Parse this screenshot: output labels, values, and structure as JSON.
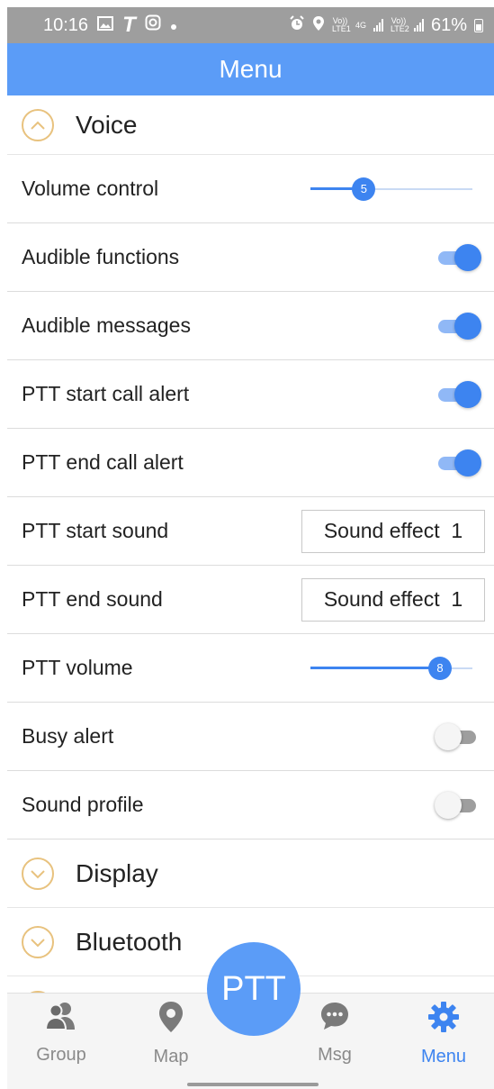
{
  "status_bar": {
    "time": "10:16",
    "left_icons": [
      "gallery-icon",
      "t-icon",
      "instagram-icon",
      "dot-icon"
    ],
    "volte1": "Vo)) LTE1",
    "network": "4G",
    "volte2": "Vo)) LTE2",
    "battery": "61%"
  },
  "app_bar": {
    "title": "Menu"
  },
  "sections": {
    "voice": {
      "title": "Voice"
    },
    "display": {
      "title": "Display"
    },
    "bluetooth": {
      "title": "Bluetooth"
    }
  },
  "settings": {
    "volume_control": {
      "label": "Volume control",
      "value": "5",
      "fraction": 0.33
    },
    "audible_functions": {
      "label": "Audible functions",
      "enabled": true
    },
    "audible_messages": {
      "label": "Audible messages",
      "enabled": true
    },
    "ptt_start_call_alert": {
      "label": "PTT start call alert",
      "enabled": true
    },
    "ptt_end_call_alert": {
      "label": "PTT end call alert",
      "enabled": true
    },
    "ptt_start_sound": {
      "label": "PTT start sound",
      "value": "Sound effect  1"
    },
    "ptt_end_sound": {
      "label": "PTT end sound",
      "value": "Sound effect  1"
    },
    "ptt_volume": {
      "label": "PTT volume",
      "value": "8",
      "fraction": 0.8
    },
    "busy_alert": {
      "label": "Busy alert",
      "enabled": false
    },
    "sound_profile": {
      "label": "Sound profile",
      "enabled": false
    }
  },
  "ptt_button": {
    "label": "PTT"
  },
  "bottom_nav": {
    "group": "Group",
    "map": "Map",
    "msg": "Msg",
    "menu": "Menu",
    "active": "menu"
  },
  "colors": {
    "accent": "#3d84f0",
    "app_bar": "#5b9cf7",
    "chevron": "#e8c27e",
    "status_bar": "#9e9e9e"
  }
}
